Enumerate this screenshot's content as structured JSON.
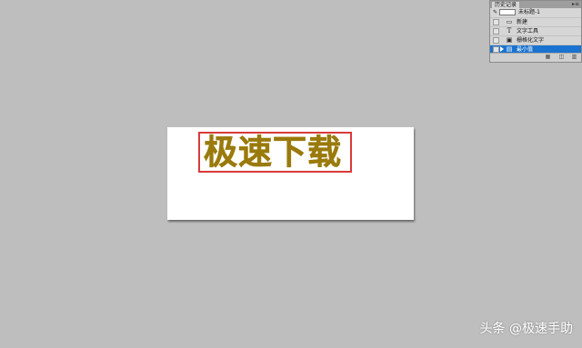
{
  "colors": {
    "workspace": "#bebebe",
    "document": "#ffffff",
    "headline_text": "#9a7a0c",
    "selection_border": "#d93a3a",
    "history_selected": "#1a73cf"
  },
  "document": {
    "headline": "极速下载"
  },
  "history_panel": {
    "tab_label": "历史记录",
    "menu_icon": "panel-menu-icon",
    "snapshot": {
      "label": "未标题-1"
    },
    "items": [
      {
        "label": "新建",
        "icon": "new-document-icon"
      },
      {
        "label": "文字工具",
        "icon": "type-tool-icon"
      },
      {
        "label": "栅格化文字",
        "icon": "rasterize-icon"
      },
      {
        "label": "最小值",
        "icon": "filter-icon",
        "selected": true
      }
    ],
    "footer_icons": [
      "new-document-from-state-icon",
      "new-snapshot-icon",
      "delete-icon"
    ]
  },
  "watermark": {
    "text": "头条 @极速手助"
  }
}
